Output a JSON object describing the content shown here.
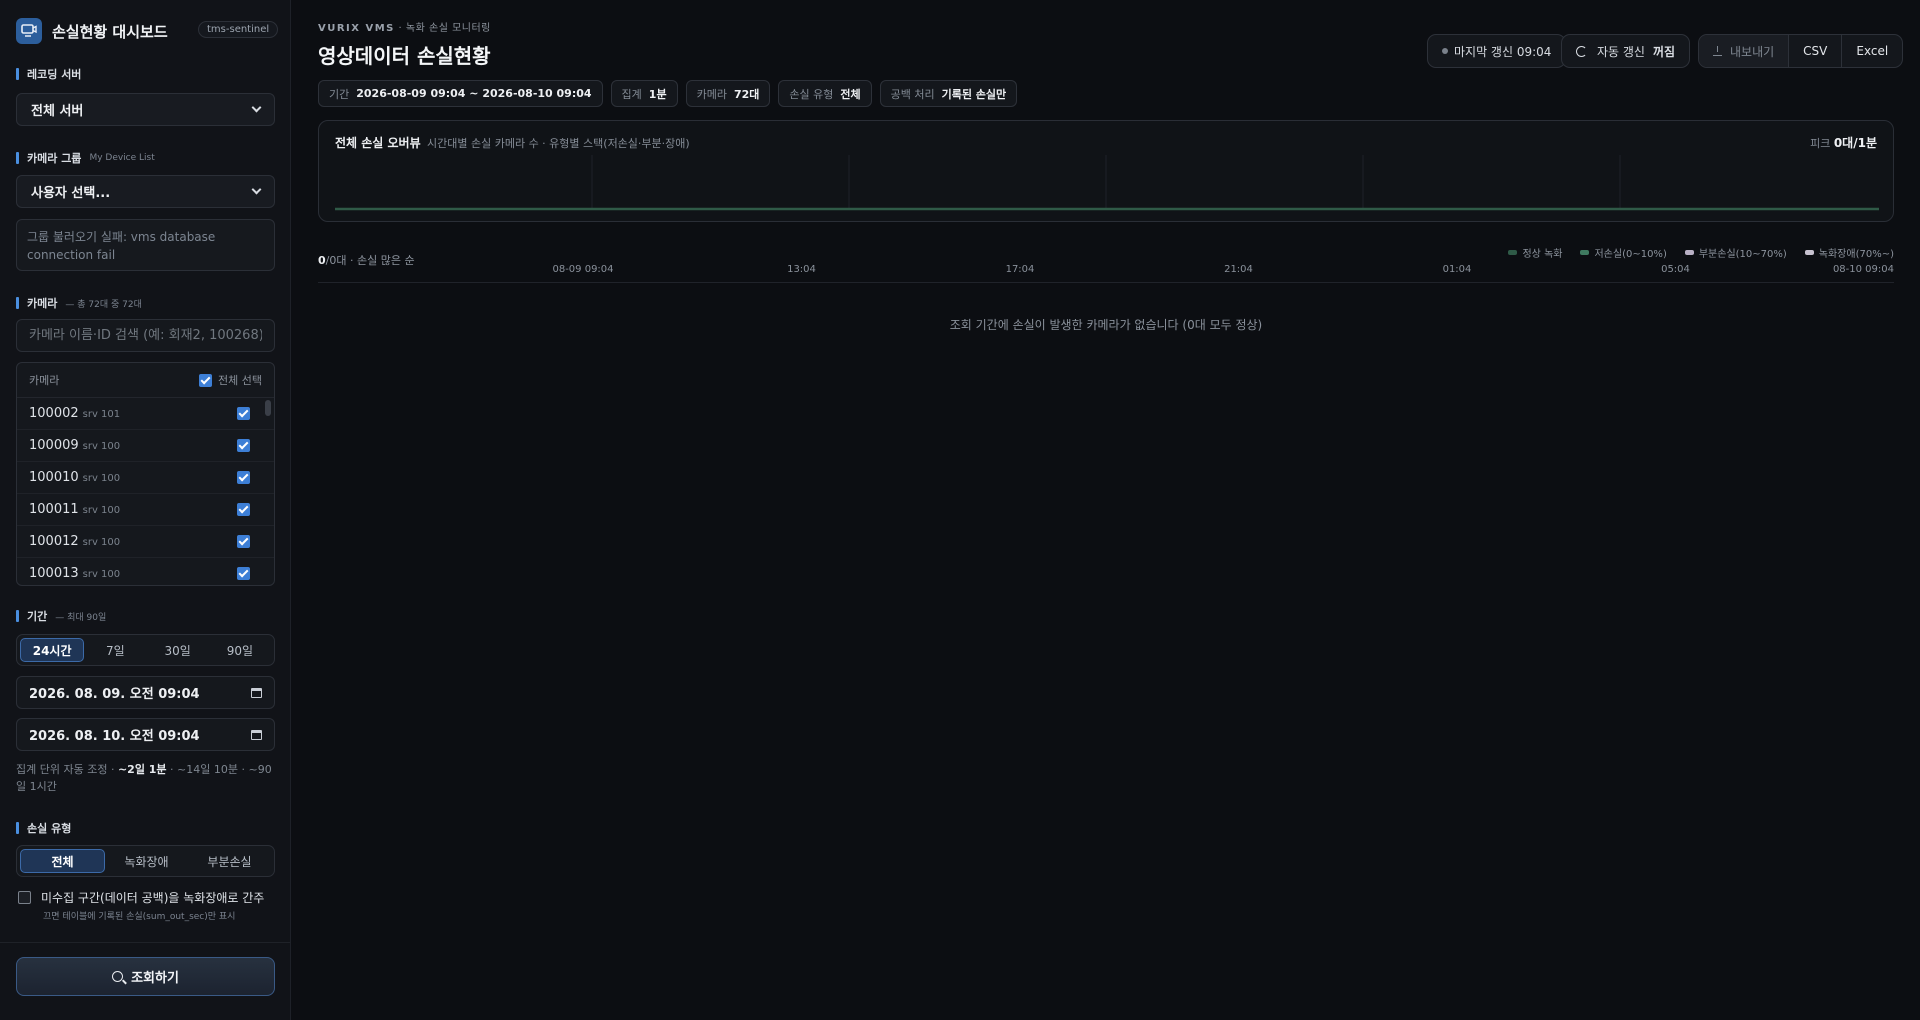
{
  "brand": {
    "title": "손실현황 대시보드",
    "tag": "tms-sentinel",
    "icon": "monitor-icon"
  },
  "sidebar": {
    "recording_server": {
      "label": "레코딩 서버",
      "value": "전체 서버"
    },
    "camera_group": {
      "label": "카메라 그룹",
      "sub": "My Device List",
      "value": "사용자 선택...",
      "error": "그룹 불러오기 실패: vms database connection fail"
    },
    "cameras": {
      "label": "카메라",
      "sub": "— 총 72대 중 72대",
      "search_placeholder": "카메라 이름·ID 검색 (예: 회재2, 100268)",
      "list_header": "카메라",
      "select_all": "전체 선택",
      "items": [
        {
          "id": "100002",
          "srv": "srv 101",
          "checked": true
        },
        {
          "id": "100009",
          "srv": "srv 100",
          "checked": true
        },
        {
          "id": "100010",
          "srv": "srv 100",
          "checked": true
        },
        {
          "id": "100011",
          "srv": "srv 100",
          "checked": true
        },
        {
          "id": "100012",
          "srv": "srv 100",
          "checked": true
        },
        {
          "id": "100013",
          "srv": "srv 100",
          "checked": true
        }
      ]
    },
    "period": {
      "label": "기간",
      "sub": "— 최대 90일",
      "options": [
        "24시간",
        "7일",
        "30일",
        "90일"
      ],
      "active": "24시간",
      "start": "2026. 08. 09. 오전 09:04",
      "end": "2026. 08. 10. 오전 09:04",
      "agg_prefix": "집계 단위 자동 조정 · ",
      "agg_current": "~2일 1분",
      "agg_rest": " · ~14일 10분 · ~90일 1시간"
    },
    "loss_type": {
      "label": "손실 유형",
      "options": [
        "전체",
        "녹화장애",
        "부분손실"
      ],
      "active": "전체",
      "gap_checkbox": "미수집 구간(데이터 공백)을 녹화장애로 간주",
      "gap_checked": false,
      "gap_note": "끄면 테이블에 기록된 손실(sum_out_sec)만 표시"
    },
    "query_button": "조회하기"
  },
  "header": {
    "kicker_brand": "VURIX VMS",
    "kicker_rest": " · 녹화 손실 모니터링",
    "title": "영상데이터 손실현황",
    "last_update": "마지막 갱신 09:04",
    "auto_refresh_label": "자동 갱신",
    "auto_refresh_state": "꺼짐",
    "export_label": "내보내기",
    "export_csv": "CSV",
    "export_excel": "Excel"
  },
  "filters": [
    {
      "key": "기간",
      "value": "2026-08-09 09:04 ~ 2026-08-10 09:04"
    },
    {
      "key": "집계",
      "value": "1분"
    },
    {
      "key": "카메라",
      "value": "72대"
    },
    {
      "key": "손실 유형",
      "value": "전체"
    },
    {
      "key": "공백 처리",
      "value": "기록된 손실만"
    }
  ],
  "overview": {
    "title": "전체 손실 오버뷰",
    "desc": "시간대별 손실 카메라 수 · 유형별 스택(저손실·부분·장애)",
    "peak_label": "피크",
    "peak_value": "0대/1분"
  },
  "timeline": {
    "summary_count": "0",
    "summary_rest": "/0대 · 손실 많은 순",
    "ticks": [
      "08-09 09:04",
      "13:04",
      "17:04",
      "21:04",
      "01:04",
      "05:04",
      "08-10 09:04"
    ],
    "legend": [
      {
        "label": "정상 녹화",
        "color": "#2f5a47"
      },
      {
        "label": "저손실(0~10%)",
        "color": "#3f7a60"
      },
      {
        "label": "부분손실(10~70%)",
        "color": "#b9b0c4"
      },
      {
        "label": "녹화장애(70%~)",
        "color": "#c7c2cf"
      }
    ],
    "empty_message": "조회 기간에 손실이 발생한 카메라가 없습니다 (0대 모두 정상)"
  }
}
